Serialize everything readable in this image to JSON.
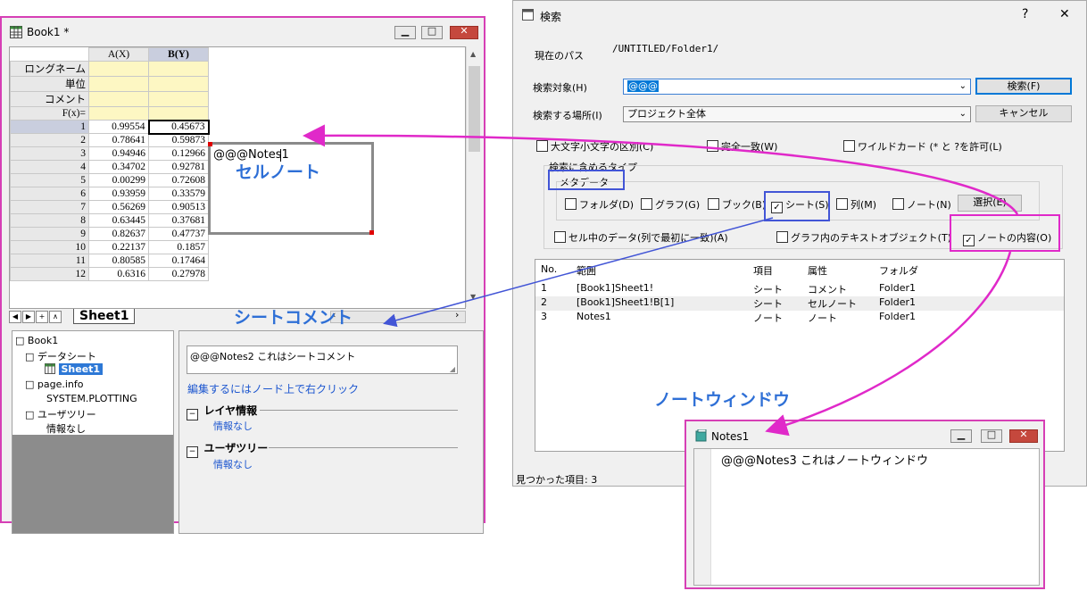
{
  "book": {
    "title": "Book1 *",
    "columns": [
      "A(X)",
      "B(Y)"
    ],
    "meta_rows": [
      "ロングネーム",
      "単位",
      "コメント",
      "F(x)="
    ],
    "rows": [
      {
        "n": "1",
        "a": "0.99554",
        "b": "0.45673"
      },
      {
        "n": "2",
        "a": "0.78641",
        "b": "0.59873"
      },
      {
        "n": "3",
        "a": "0.94946",
        "b": "0.12966"
      },
      {
        "n": "4",
        "a": "0.34702",
        "b": "0.92781"
      },
      {
        "n": "5",
        "a": "0.00299",
        "b": "0.72608"
      },
      {
        "n": "6",
        "a": "0.93959",
        "b": "0.33579"
      },
      {
        "n": "7",
        "a": "0.56269",
        "b": "0.90513"
      },
      {
        "n": "8",
        "a": "0.63445",
        "b": "0.37681"
      },
      {
        "n": "9",
        "a": "0.82637",
        "b": "0.47737"
      },
      {
        "n": "10",
        "a": "0.22137",
        "b": "0.1857"
      },
      {
        "n": "11",
        "a": "0.80585",
        "b": "0.17464"
      },
      {
        "n": "12",
        "a": "0.6316",
        "b": "0.27978"
      }
    ],
    "cell_note": "@@@Notes1",
    "sheet_tab": "Sheet1",
    "tree": {
      "root": "Book1",
      "datasheet": "データシート",
      "sheet": "Sheet1",
      "pageinfo": "page.info",
      "plotting": "SYSTEM.PLOTTING",
      "usertree": "ユーザツリー",
      "noinfo": "情報なし"
    },
    "info": {
      "comment": "@@@Notes2 これはシートコメント",
      "hint": "編集するにはノード上で右クリック",
      "layer_title": "レイヤ情報",
      "layer_value": "情報なし",
      "user_title": "ユーザツリー",
      "user_value": "情報なし"
    }
  },
  "search": {
    "title": "検索",
    "help": "?",
    "close": "✕",
    "path_label": "現在のパス",
    "path_value": "/UNTITLED/Folder1/",
    "target_label": "検索対象(H)",
    "target_value": "@@@",
    "location_label": "検索する場所(I)",
    "location_value": "プロジェクト全体",
    "search_button": "検索(F)",
    "cancel_button": "キャンセル",
    "opt_case": "大文字小文字の区別(C)",
    "opt_exact": "完全一致(W)",
    "opt_wild": "ワイルドカード (* と ?を許可(L)",
    "types_label": "検索に含めるタイプ",
    "metadata_label": "メタデータ",
    "types": {
      "folder": "フォルダ(D)",
      "graph": "グラフ(G)",
      "book": "ブック(B)",
      "sheet": "シート(S)",
      "column": "列(M)",
      "note": "ノート(N)",
      "select": "選択(E)"
    },
    "opt_celldata": "セル中のデータ(列で最初に一致)(A)",
    "opt_graphtext": "グラフ内のテキストオブジェクト(T)",
    "opt_notecontent": "ノートの内容(O)",
    "results_header": [
      "No.",
      "範囲",
      "項目",
      "属性",
      "フォルダ"
    ],
    "results": [
      {
        "no": "1",
        "range": "[Book1]Sheet1!",
        "item": "シート",
        "attr": "コメント",
        "folder": "Folder1"
      },
      {
        "no": "2",
        "range": "[Book1]Sheet1!B[1]",
        "item": "シート",
        "attr": "セルノート",
        "folder": "Folder1"
      },
      {
        "no": "3",
        "range": "Notes1",
        "item": "ノート",
        "attr": "ノート",
        "folder": "Folder1"
      }
    ],
    "status": "見つかった項目: 3"
  },
  "notes": {
    "title": "Notes1",
    "content": "@@@Notes3  これはノートウィンドウ"
  },
  "annotations": {
    "cell_note": "セルノート",
    "sheet_comment": "シートコメント",
    "note_window": "ノートウィンドウ"
  },
  "colors": {
    "pink": "#e029c9",
    "blue": "#4255d6",
    "annotation_text": "#2e6fd6"
  }
}
